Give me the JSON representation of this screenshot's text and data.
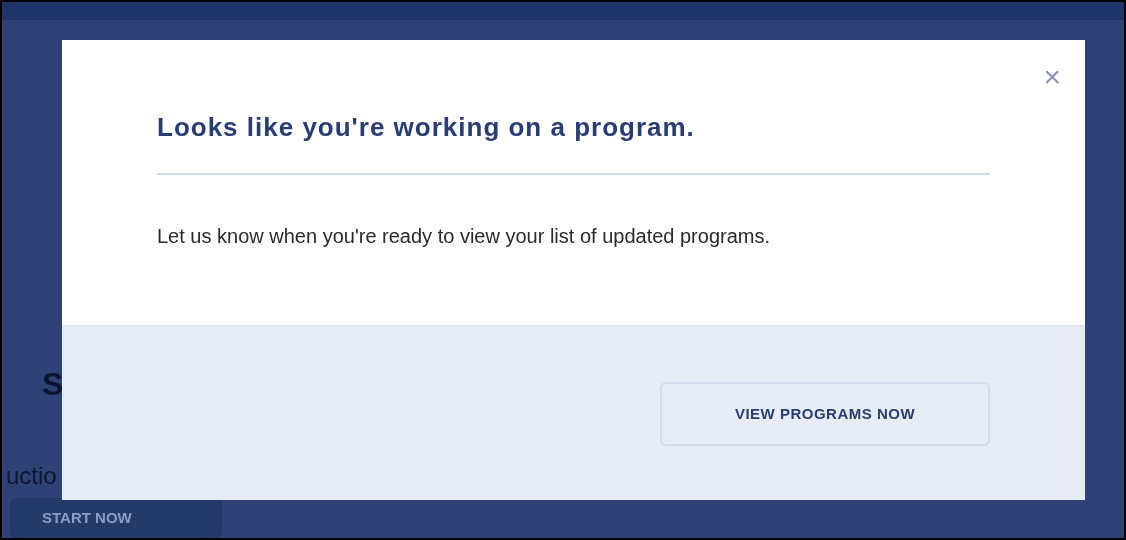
{
  "background": {
    "heading_fragment": "S",
    "text_fragment": "uctio",
    "start_button": "START NOW"
  },
  "dialog": {
    "close": "×",
    "title": "Looks like you're working on a program.",
    "message": "Let us know when you're ready to view your list of updated programs.",
    "button": "VIEW PROGRAMS NOW"
  }
}
